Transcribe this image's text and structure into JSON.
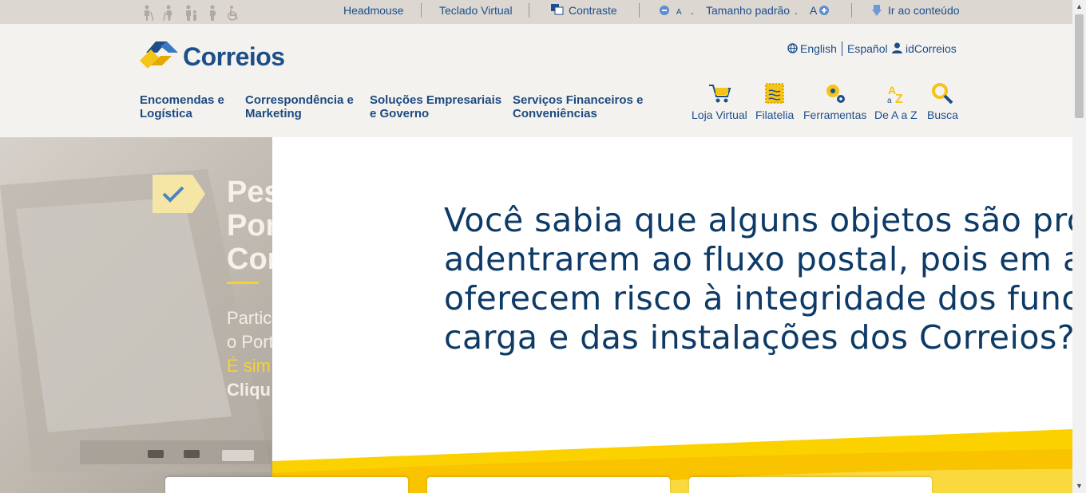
{
  "accessibility_bar": {
    "headmouse": "Headmouse",
    "teclado_virtual": "Teclado Virtual",
    "contraste": "Contraste",
    "font_decrease": "A",
    "tamanho_padrao": "Tamanho padrão",
    "font_increase": "A",
    "ir_ao_conteudo": "Ir ao conteúdo"
  },
  "header": {
    "logo_text": "Correios",
    "languages": [
      "English",
      "Español"
    ],
    "id_correios": "idCorreios",
    "nav": [
      {
        "line1": "Encomendas e",
        "line2": "Logística"
      },
      {
        "line1": "Correspondência e",
        "line2": "Marketing"
      },
      {
        "line1": "Soluções Empresariais",
        "line2": "e Governo"
      },
      {
        "line1": "Serviços Financeiros e",
        "line2": "Conveniências"
      }
    ],
    "tools": [
      "Loja Virtual",
      "Filatelia",
      "Ferramentas",
      "De A a Z",
      "Busca"
    ]
  },
  "hero": {
    "title_lines": [
      "Pes",
      "Por",
      "Cor"
    ],
    "text_lines": [
      "Partic",
      "o Port",
      "É sim",
      "Cliqu"
    ]
  },
  "modal": {
    "lines": [
      "Você sabia que alguns objetos são proibi",
      "adentrarem ao fluxo postal, pois em alguns",
      "oferecem risco à integridade dos funcionár",
      "carga e das instalações dos Correios?"
    ]
  },
  "colors": {
    "brand_blue": "#1c4f8a",
    "brand_yellow": "#f7d22e",
    "modal_text": "#0d3a66"
  }
}
